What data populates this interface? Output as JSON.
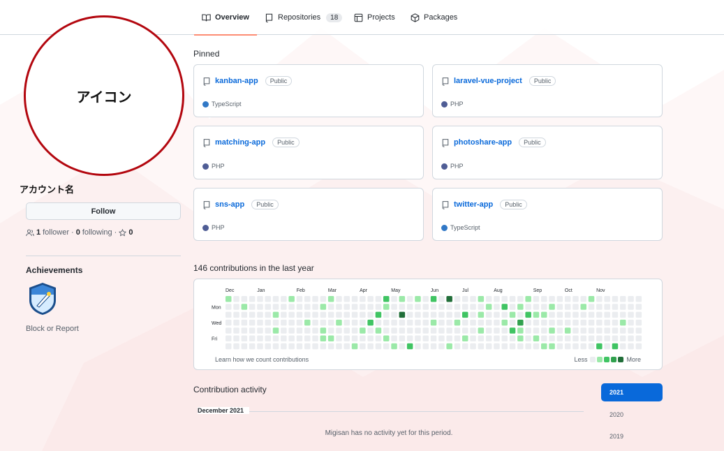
{
  "tabs": [
    {
      "label": "Overview",
      "icon": "book-icon",
      "selected": true
    },
    {
      "label": "Repositories",
      "icon": "repo-icon",
      "count": "18"
    },
    {
      "label": "Projects",
      "icon": "table-icon"
    },
    {
      "label": "Packages",
      "icon": "package-icon"
    }
  ],
  "profile": {
    "avatar_text": "アイコン",
    "account_name": "アカウント名",
    "follow_label": "Follow",
    "followers_count": "1",
    "followers_label": "follower",
    "following_count": "0",
    "following_label": "following",
    "stars_count": "0",
    "achievements_title": "Achievements",
    "block_report": "Block or Report"
  },
  "pinned": {
    "title": "Pinned",
    "public_label": "Public",
    "repos": [
      {
        "name": "kanban-app",
        "language": "TypeScript",
        "lang_color": "#3178c6"
      },
      {
        "name": "laravel-vue-project",
        "language": "PHP",
        "lang_color": "#4f5d95"
      },
      {
        "name": "matching-app",
        "language": "PHP",
        "lang_color": "#4f5d95"
      },
      {
        "name": "photoshare-app",
        "language": "PHP",
        "lang_color": "#4f5d95"
      },
      {
        "name": "sns-app",
        "language": "PHP",
        "lang_color": "#4f5d95"
      },
      {
        "name": "twitter-app",
        "language": "TypeScript",
        "lang_color": "#3178c6"
      }
    ]
  },
  "contributions": {
    "title": "146 contributions in the last year",
    "months": [
      "Dec",
      "Jan",
      "Feb",
      "Mar",
      "Apr",
      "May",
      "Jun",
      "Jul",
      "Aug",
      "Sep",
      "Oct",
      "Nov"
    ],
    "month_weeks": [
      0,
      4,
      9,
      13,
      17,
      21,
      26,
      30,
      34,
      39,
      43,
      47
    ],
    "days": [
      "Mon",
      "Wed",
      "Fri"
    ],
    "level_colors": [
      "#ebedf0",
      "#9be9a8",
      "#40c463",
      "#30a14e",
      "#216e39"
    ],
    "levels": [
      {
        "w": 0,
        "d": 0,
        "l": 1
      },
      {
        "w": 2,
        "d": 1,
        "l": 1
      },
      {
        "w": 6,
        "d": 2,
        "l": 1
      },
      {
        "w": 6,
        "d": 4,
        "l": 1
      },
      {
        "w": 8,
        "d": 0,
        "l": 1
      },
      {
        "w": 10,
        "d": 3,
        "l": 1
      },
      {
        "w": 12,
        "d": 1,
        "l": 1
      },
      {
        "w": 12,
        "d": 4,
        "l": 1
      },
      {
        "w": 12,
        "d": 5,
        "l": 1
      },
      {
        "w": 13,
        "d": 0,
        "l": 1
      },
      {
        "w": 13,
        "d": 5,
        "l": 1
      },
      {
        "w": 14,
        "d": 3,
        "l": 1
      },
      {
        "w": 16,
        "d": 6,
        "l": 1
      },
      {
        "w": 17,
        "d": 4,
        "l": 1
      },
      {
        "w": 18,
        "d": 3,
        "l": 2
      },
      {
        "w": 19,
        "d": 2,
        "l": 2
      },
      {
        "w": 19,
        "d": 4,
        "l": 1
      },
      {
        "w": 20,
        "d": 0,
        "l": 2
      },
      {
        "w": 20,
        "d": 1,
        "l": 1
      },
      {
        "w": 20,
        "d": 5,
        "l": 1
      },
      {
        "w": 21,
        "d": 6,
        "l": 1
      },
      {
        "w": 22,
        "d": 0,
        "l": 1
      },
      {
        "w": 22,
        "d": 2,
        "l": 4
      },
      {
        "w": 23,
        "d": 6,
        "l": 2
      },
      {
        "w": 24,
        "d": 0,
        "l": 1
      },
      {
        "w": 26,
        "d": 0,
        "l": 2
      },
      {
        "w": 26,
        "d": 3,
        "l": 1
      },
      {
        "w": 28,
        "d": 0,
        "l": 4
      },
      {
        "w": 28,
        "d": 6,
        "l": 1
      },
      {
        "w": 29,
        "d": 3,
        "l": 1
      },
      {
        "w": 30,
        "d": 2,
        "l": 2
      },
      {
        "w": 30,
        "d": 5,
        "l": 1
      },
      {
        "w": 32,
        "d": 0,
        "l": 1
      },
      {
        "w": 32,
        "d": 2,
        "l": 1
      },
      {
        "w": 32,
        "d": 4,
        "l": 1
      },
      {
        "w": 33,
        "d": 1,
        "l": 1
      },
      {
        "w": 35,
        "d": 1,
        "l": 2
      },
      {
        "w": 35,
        "d": 3,
        "l": 1
      },
      {
        "w": 36,
        "d": 2,
        "l": 1
      },
      {
        "w": 36,
        "d": 4,
        "l": 2
      },
      {
        "w": 37,
        "d": 1,
        "l": 1
      },
      {
        "w": 37,
        "d": 3,
        "l": 3
      },
      {
        "w": 37,
        "d": 4,
        "l": 1
      },
      {
        "w": 37,
        "d": 5,
        "l": 1
      },
      {
        "w": 38,
        "d": 0,
        "l": 1
      },
      {
        "w": 38,
        "d": 2,
        "l": 2
      },
      {
        "w": 39,
        "d": 2,
        "l": 1
      },
      {
        "w": 39,
        "d": 5,
        "l": 1
      },
      {
        "w": 40,
        "d": 2,
        "l": 1
      },
      {
        "w": 40,
        "d": 6,
        "l": 1
      },
      {
        "w": 41,
        "d": 1,
        "l": 1
      },
      {
        "w": 41,
        "d": 4,
        "l": 1
      },
      {
        "w": 41,
        "d": 6,
        "l": 1
      },
      {
        "w": 43,
        "d": 4,
        "l": 1
      },
      {
        "w": 45,
        "d": 1,
        "l": 1
      },
      {
        "w": 46,
        "d": 0,
        "l": 1
      },
      {
        "w": 47,
        "d": 6,
        "l": 2
      },
      {
        "w": 49,
        "d": 6,
        "l": 2
      },
      {
        "w": 50,
        "d": 3,
        "l": 1
      },
      {
        "w": 53,
        "d": 2,
        "l": 1
      },
      {
        "w": 56,
        "d": 1,
        "l": 1
      },
      {
        "w": 56,
        "d": 5,
        "l": 1
      },
      {
        "w": 57,
        "d": 6,
        "l": 1
      }
    ],
    "learn_link": "Learn how we count contributions",
    "legend_less": "Less",
    "legend_more": "More"
  },
  "activity": {
    "title": "Contribution activity",
    "month": "December 2021",
    "empty": "Migisan has no activity yet for this period.",
    "years": [
      "2021",
      "2020",
      "2019"
    ],
    "selected_year": "2021"
  }
}
